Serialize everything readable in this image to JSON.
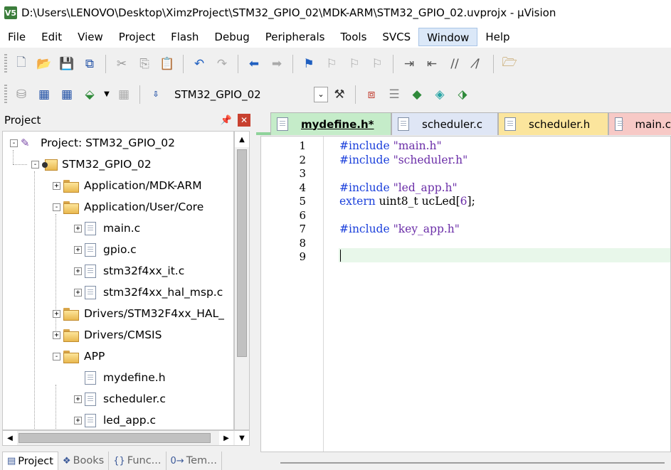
{
  "window": {
    "app_icon_text": "V5",
    "title": "D:\\Users\\LENOVO\\Desktop\\XimzProject\\STM32_GPIO_02\\MDK-ARM\\STM32_GPIO_02.uvprojx - µVision"
  },
  "menu": [
    "File",
    "Edit",
    "View",
    "Project",
    "Flash",
    "Debug",
    "Peripherals",
    "Tools",
    "SVCS",
    "Window",
    "Help"
  ],
  "toolbar2": {
    "target_select": "STM32_GPIO_02"
  },
  "project_panel": {
    "title": "Project",
    "tree": [
      {
        "label": "Project: STM32_GPIO_02",
        "type": "project",
        "expander": "-"
      },
      {
        "label": "STM32_GPIO_02",
        "type": "target",
        "expander": "-"
      },
      {
        "label": "Application/MDK-ARM",
        "type": "folder",
        "expander": "+"
      },
      {
        "label": "Application/User/Core",
        "type": "folder",
        "expander": "-"
      },
      {
        "label": "main.c",
        "type": "file",
        "expander": "+"
      },
      {
        "label": "gpio.c",
        "type": "file",
        "expander": "+"
      },
      {
        "label": "stm32f4xx_it.c",
        "type": "file",
        "expander": "+"
      },
      {
        "label": "stm32f4xx_hal_msp.c",
        "type": "file",
        "expander": "+"
      },
      {
        "label": "Drivers/STM32F4xx_HAL_",
        "type": "folder",
        "expander": "+"
      },
      {
        "label": "Drivers/CMSIS",
        "type": "folder",
        "expander": "+"
      },
      {
        "label": "APP",
        "type": "folder",
        "expander": "-"
      },
      {
        "label": "mydefine.h",
        "type": "file",
        "expander": ""
      },
      {
        "label": "scheduler.c",
        "type": "file",
        "expander": "+"
      },
      {
        "label": "led_app.c",
        "type": "file",
        "expander": "+"
      }
    ],
    "bottom_tabs": [
      {
        "icon": "project-tab-icon",
        "glyph": "▤",
        "label": "Project"
      },
      {
        "icon": "books-tab-icon",
        "glyph": "❖",
        "label": "Books"
      },
      {
        "icon": "functions-tab-icon",
        "glyph": "{}",
        "label": "Func..."
      },
      {
        "icon": "templates-tab-icon",
        "glyph": "0→",
        "label": "Tem..."
      }
    ]
  },
  "editor": {
    "tabs": [
      {
        "label": "mydefine.h*",
        "color": "#c5ecc9",
        "active": true
      },
      {
        "label": "scheduler.c",
        "color": "#dfe6f5",
        "active": false
      },
      {
        "label": "scheduler.h",
        "color": "#fbe59d",
        "active": false
      },
      {
        "label": "main.c",
        "color": "#f7c9c6",
        "active": false
      }
    ],
    "line_numbers": [
      "1",
      "2",
      "3",
      "4",
      "5",
      "6",
      "7",
      "8",
      "9"
    ],
    "code": {
      "l1": {
        "kw": "#include",
        "str": "\"main.h\""
      },
      "l2": {
        "kw": "#include",
        "str": "\"scheduler.h\""
      },
      "l4": {
        "kw": "#include",
        "str": "\"led_app.h\""
      },
      "l5": {
        "kw": "extern",
        "rest": " uint8_t ucLed[",
        "num": "6",
        "end": "];"
      },
      "l7": {
        "kw": "#include",
        "str": "\"key_app.h\""
      }
    }
  },
  "colors": {
    "active_tab_underline": "#8fd39b",
    "current_line": "#e8f7ea",
    "keyword": "#1a3fdb",
    "string": "#6b2ea8"
  }
}
